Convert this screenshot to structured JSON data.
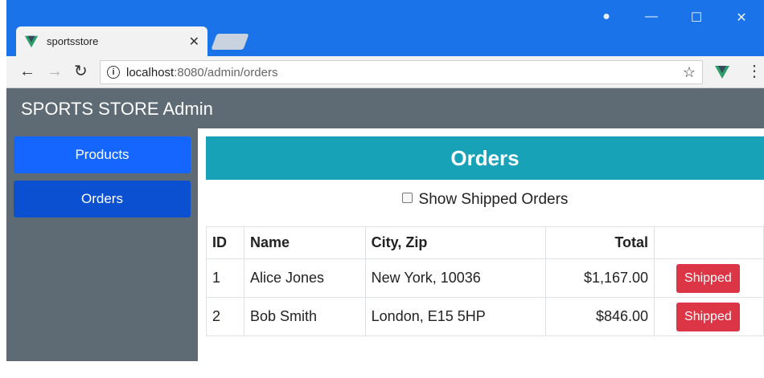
{
  "browser": {
    "tab_title": "sportsstore",
    "tab_close": "✕",
    "url_host": "localhost",
    "url_path": ":8080/admin/orders",
    "colors": {
      "titlebar": "#1a73e8",
      "vue_green": "#2e9e6a"
    }
  },
  "app": {
    "header_title": "SPORTS STORE Admin",
    "sidebar": {
      "items": [
        {
          "label": "Products"
        },
        {
          "label": "Orders"
        }
      ]
    },
    "main": {
      "title": "Orders",
      "filter_label": "Show Shipped Orders",
      "table": {
        "headers": [
          "ID",
          "Name",
          "City, Zip",
          "Total",
          ""
        ],
        "rows": [
          {
            "id": "1",
            "name": "Alice Jones",
            "city": "New York, 10036",
            "total": "$1,167.00",
            "action": "Shipped"
          },
          {
            "id": "2",
            "name": "Bob Smith",
            "city": "London, E15 5HP",
            "total": "$846.00",
            "action": "Shipped"
          }
        ]
      }
    },
    "colors": {
      "header_bg": "#5e6b74",
      "products_button": "#1565ff",
      "orders_button": "#0b50d0",
      "orders_title_bg": "#17a2b8",
      "shipped_button": "#dc3545"
    }
  }
}
